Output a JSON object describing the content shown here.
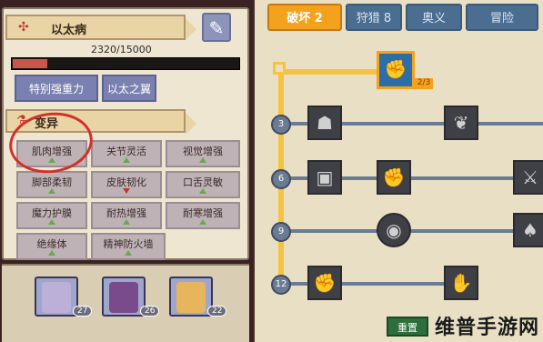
{
  "left_panel": {
    "disease_name": "以太病",
    "hp_text": "2320/15000",
    "hp_progress": 0.1547,
    "special_buttons": [
      "特别强重力",
      "以太之翼"
    ],
    "mutation_header": "变异",
    "mutations": [
      {
        "label": "肌肉增强",
        "trend": "up"
      },
      {
        "label": "关节灵活",
        "trend": "up"
      },
      {
        "label": "视觉增强",
        "trend": "up"
      },
      {
        "label": "脚部柔韧",
        "trend": "up"
      },
      {
        "label": "皮肤韧化",
        "trend": "down"
      },
      {
        "label": "口舌灵敏",
        "trend": "up"
      },
      {
        "label": "魔力护膜",
        "trend": "up"
      },
      {
        "label": "耐热增强",
        "trend": "up"
      },
      {
        "label": "耐寒增强",
        "trend": "up"
      },
      {
        "label": "绝缘体",
        "trend": "up"
      },
      {
        "label": "精神防火墙",
        "trend": "up"
      }
    ],
    "cards": [
      {
        "count": "27"
      },
      {
        "count": "26"
      },
      {
        "count": "22"
      }
    ]
  },
  "right_panel": {
    "tabs": [
      {
        "label": "破坏 2",
        "active": true
      },
      {
        "label": "狩猎 8",
        "active": false
      },
      {
        "label": "奥义",
        "active": false
      },
      {
        "label": "冒险",
        "active": false
      }
    ],
    "tree_levels": [
      "3",
      "6",
      "9",
      "12"
    ],
    "top_node_count": "2/3",
    "reset_label": "重置"
  },
  "watermark": "维普手游网",
  "colors": {
    "accent": "#f4a21e",
    "tab_blue": "#4b6d90",
    "annotation_red": "#d4302a"
  }
}
